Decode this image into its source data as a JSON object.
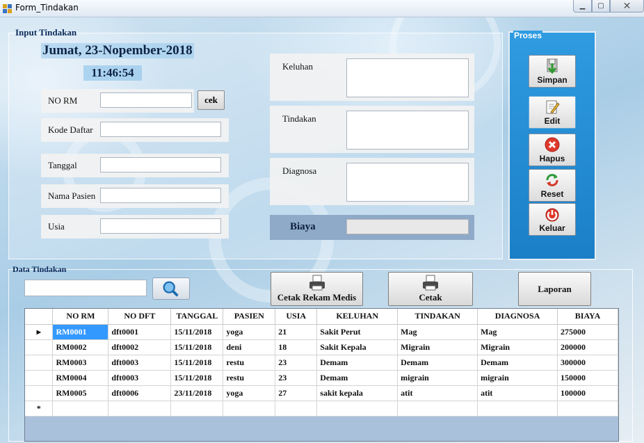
{
  "window": {
    "title": "Form_Tindakan",
    "minimize_glyph": "▁",
    "maximize_glyph": "▢",
    "close_glyph": "✕"
  },
  "input_group": {
    "label": "Input Tindakan",
    "date": "Jumat, 23-Nopember-2018",
    "time": "11:46:54",
    "no_rm_label": "NO RM",
    "no_rm_value": "",
    "cek_label": "cek",
    "kode_daftar_label": "Kode Daftar",
    "kode_daftar_value": "",
    "tanggal_label": "Tanggal",
    "tanggal_value": "",
    "nama_pasien_label": "Nama Pasien",
    "nama_pasien_value": "",
    "usia_label": "Usia",
    "usia_value": "",
    "keluhan_label": "Keluhan",
    "keluhan_value": "",
    "tindakan_label": "Tindakan",
    "tindakan_value": "",
    "diagnosa_label": "Diagnosa",
    "diagnosa_value": "",
    "biaya_label": "Biaya",
    "biaya_value": ""
  },
  "proses_group": {
    "label": "Proses",
    "buttons": [
      {
        "label": "Simpan",
        "icon": "save-icon"
      },
      {
        "label": "Edit",
        "icon": "edit-icon"
      },
      {
        "label": "Hapus",
        "icon": "delete-icon"
      },
      {
        "label": "Reset",
        "icon": "refresh-icon"
      },
      {
        "label": "Keluar",
        "icon": "power-icon"
      }
    ]
  },
  "data_group": {
    "label": "Data Tindakan",
    "search_value": "",
    "cetak_rekam_medis_label": "Cetak Rekam Medis",
    "cetak_label": "Cetak",
    "laporan_label": "Laporan",
    "colors": {
      "selection": "#3399ff",
      "grid_background": "#aac1dc",
      "proses_panel": "#2f9be0"
    },
    "columns": [
      "NO RM",
      "NO DFT",
      "TANGGAL",
      "PASIEN",
      "USIA",
      "KELUHAN",
      "TINDAKAN",
      "DIAGNOSA",
      "BIAYA"
    ],
    "rows": [
      [
        "RM0001",
        "dft0001",
        "15/11/2018",
        "yoga",
        "21",
        "Sakit Perut",
        "Mag",
        "Mag",
        "275000"
      ],
      [
        "RM0002",
        "dft0002",
        "15/11/2018",
        "deni",
        "18",
        "Sakit Kepala",
        "Migrain",
        "Migrain",
        "200000"
      ],
      [
        "RM0003",
        "dft0003",
        "15/11/2018",
        "restu",
        "23",
        "Demam",
        "Demam",
        "Demam",
        "300000"
      ],
      [
        "RM0004",
        "dft0003",
        "15/11/2018",
        "restu",
        "23",
        "Demam",
        "migrain",
        "migrain",
        "150000"
      ],
      [
        "RM0005",
        "dft0006",
        "23/11/2018",
        "yoga",
        "27",
        "sakit kepala",
        "atit",
        "atit",
        "100000"
      ]
    ],
    "current_row_marker": "▸",
    "new_row_marker": "*"
  }
}
